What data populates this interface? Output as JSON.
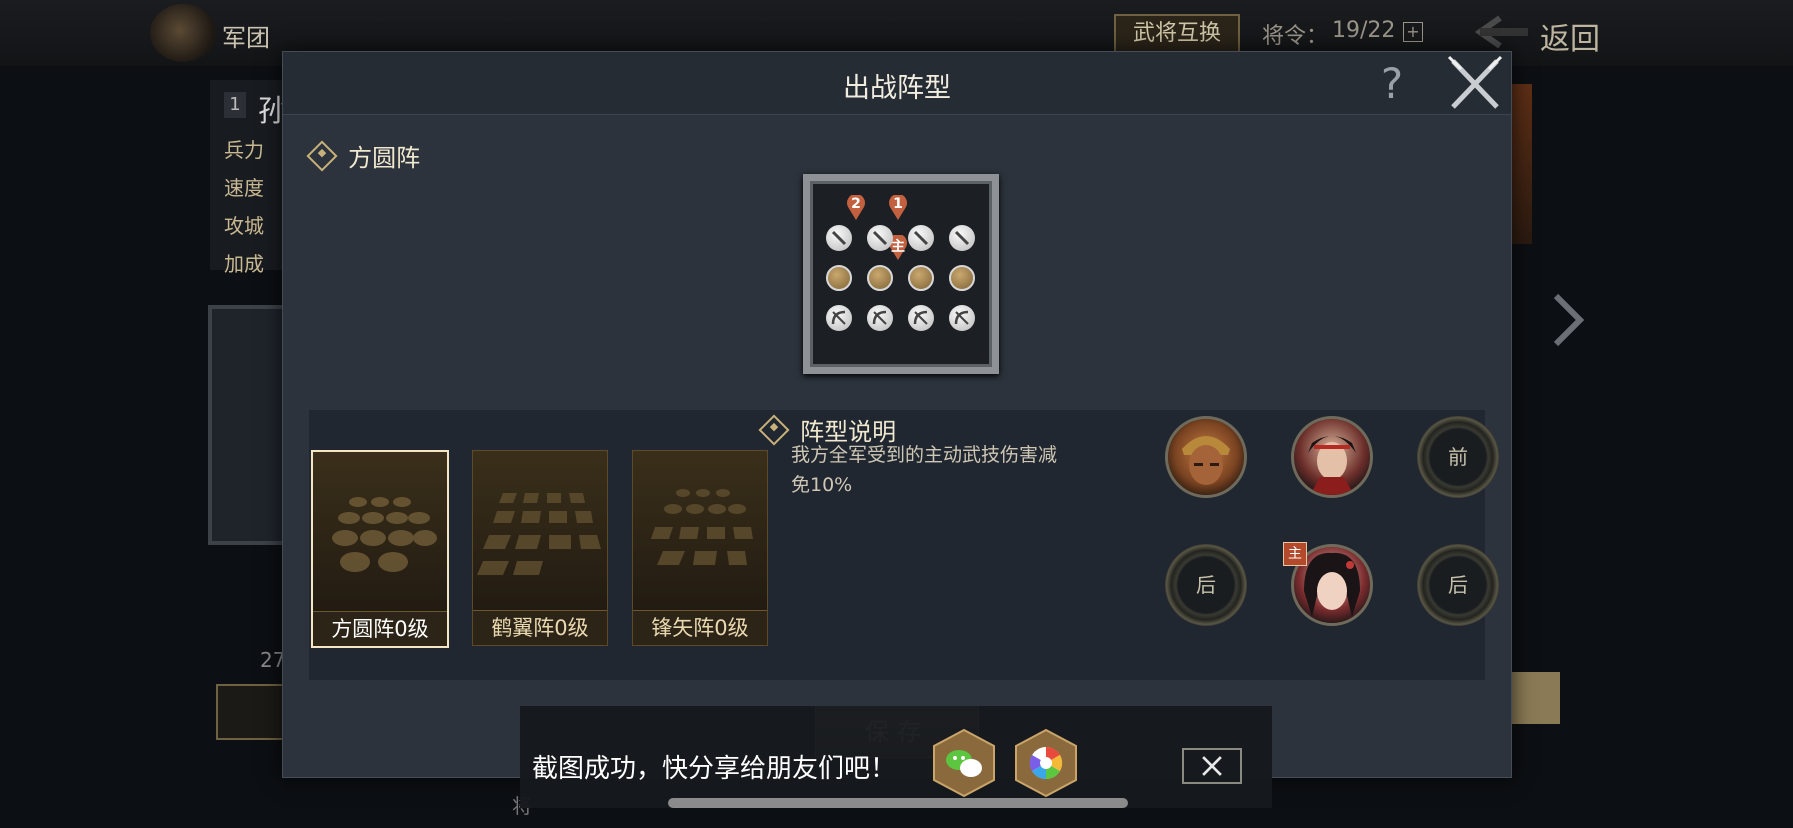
{
  "background": {
    "legion_label": "军团",
    "swap_button": "武将互换",
    "orders_label": "将令：",
    "orders_value": "19/22",
    "orders_plus": "+",
    "back_label": "返回",
    "rank": "1",
    "hero_name_fragment": "孙",
    "stats": [
      "兵力",
      "速度",
      "攻城",
      "加成"
    ],
    "level_fragment": "27",
    "bottom_fragment": "将"
  },
  "modal": {
    "title": "出战阵型",
    "help": "?",
    "formation_name": "方圆阵",
    "formation_grid": {
      "pins": [
        "2",
        "1",
        "主"
      ],
      "rows": [
        [
          "sword",
          "sword",
          "sword",
          "sword"
        ],
        [
          "shield",
          "shield",
          "shield",
          "shield"
        ],
        [
          "bow",
          "bow",
          "bow",
          "bow"
        ]
      ]
    },
    "formations": [
      {
        "label": "方圆阵0级",
        "selected": true
      },
      {
        "label": "鹤翼阵0级",
        "selected": false
      },
      {
        "label": "锋矢阵0级",
        "selected": false
      }
    ],
    "description_title": "阵型说明",
    "description_line1": "我方全军受到的主动武技伤害减",
    "description_line2": "免10%",
    "slots": [
      {
        "type": "hero",
        "name": "hero-helmeted-warrior"
      },
      {
        "type": "hero",
        "name": "hero-young-general"
      },
      {
        "type": "empty",
        "label": "前"
      },
      {
        "type": "empty",
        "label": "后"
      },
      {
        "type": "hero",
        "name": "hero-female-commander",
        "badge": "主"
      },
      {
        "type": "empty",
        "label": "后"
      }
    ],
    "save_label": "保存"
  },
  "share_toast": {
    "text": "截图成功，快分享给朋友们吧！"
  },
  "colors": {
    "modal_bg": "#2c333c",
    "gold_accent": "#c9b27a",
    "badge_red": "#b34a2c"
  }
}
